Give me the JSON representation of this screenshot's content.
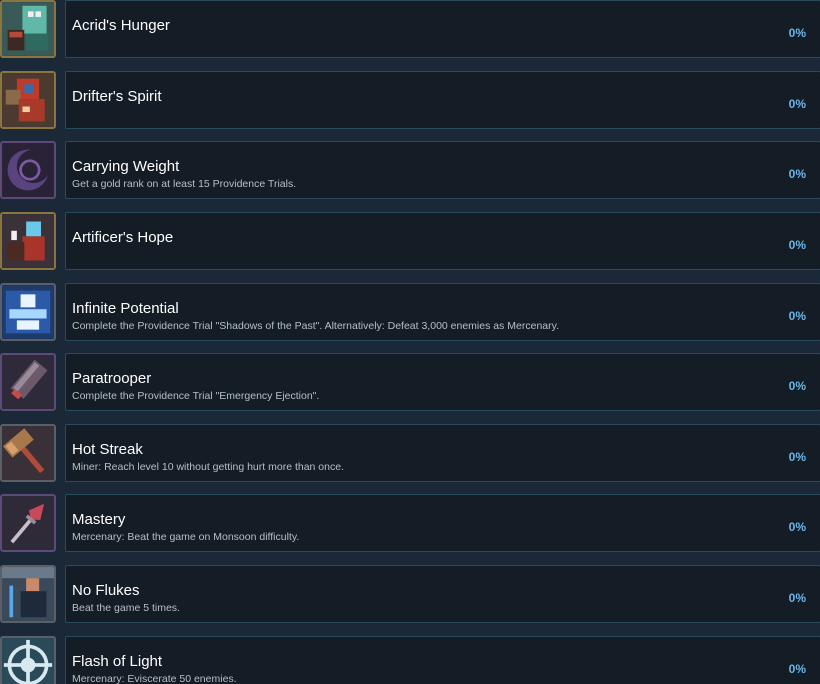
{
  "achievements": [
    {
      "title": "Acrid's Hunger",
      "description": "",
      "percent": "0%",
      "icon": "acrid-icon"
    },
    {
      "title": "Drifter's Spirit",
      "description": "",
      "percent": "0%",
      "icon": "drifter-icon"
    },
    {
      "title": "Carrying Weight",
      "description": "Get a gold rank on at least 15 Providence Trials.",
      "percent": "0%",
      "icon": "crescent-icon"
    },
    {
      "title": "Artificer's Hope",
      "description": "",
      "percent": "0%",
      "icon": "artificer-icon"
    },
    {
      "title": "Infinite Potential",
      "description": "Complete the Providence Trial \"Shadows of the Past\". Alternatively: Defeat 3,000 enemies as Mercenary.",
      "percent": "0%",
      "icon": "hologram-icon"
    },
    {
      "title": "Paratrooper",
      "description": "Complete the Providence Trial \"Emergency Ejection\".",
      "percent": "0%",
      "icon": "canister-icon"
    },
    {
      "title": "Hot Streak",
      "description": "Miner: Reach level 10 without getting hurt more than once.",
      "percent": "0%",
      "icon": "hammer-icon"
    },
    {
      "title": "Mastery",
      "description": "Mercenary: Beat the game on Monsoon difficulty.",
      "percent": "0%",
      "icon": "spear-icon"
    },
    {
      "title": "No Flukes",
      "description": "Beat the game 5 times.",
      "percent": "0%",
      "icon": "mercenary-icon"
    },
    {
      "title": "Flash of Light",
      "description": "Mercenary: Eviscerate 50 enemies.",
      "percent": "0%",
      "icon": "compass-icon"
    }
  ],
  "colors": {
    "background": "#1b2838",
    "card": "#141d26",
    "card_border": "#2a4a5e",
    "percent": "#6cb5e8"
  }
}
